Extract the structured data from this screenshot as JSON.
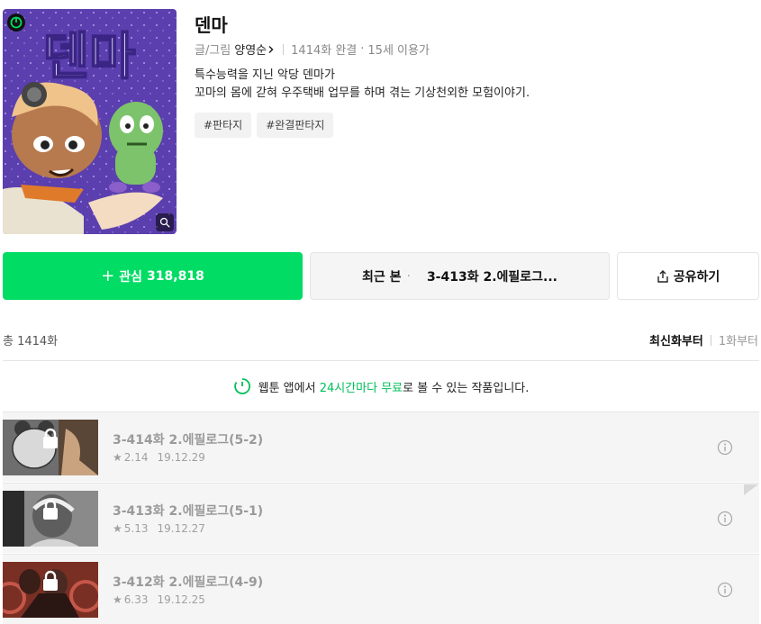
{
  "webtoon": {
    "title": "덴마",
    "cover_logo": "덴마",
    "author_prefix": "글/그림",
    "author": "양영순",
    "status": "1414화 완결",
    "age": "15세 이용가",
    "description_line1": "특수능력을 지닌 악당 덴마가",
    "description_line2": "꼬마의 몸에 갇혀 우주택배 업무를 하며 겪는 기상천외한 모험이야기.",
    "tags": [
      "#판타지",
      "#완결판타지"
    ]
  },
  "actions": {
    "favorite_label": "관심",
    "favorite_count": "318,818",
    "recent_label": "최근 본",
    "recent_episode": "3-413화 2.에필로그...",
    "share_label": "공유하기"
  },
  "list": {
    "total": "총 1414화",
    "sort_latest": "최신화부터",
    "sort_first": "1화부터",
    "notice_pre": "웹툰 앱에서 ",
    "notice_highlight": "24시간마다 무료",
    "notice_post": "로 볼 수 있는 작품입니다.",
    "episodes": [
      {
        "title": "3-414화 2.에필로그(5-2)",
        "rating": "2.14",
        "date": "19.12.29"
      },
      {
        "title": "3-413화 2.에필로그(5-1)",
        "rating": "5.13",
        "date": "19.12.27"
      },
      {
        "title": "3-412화 2.에필로그(4-9)",
        "rating": "6.33",
        "date": "19.12.25"
      }
    ]
  },
  "icons": {
    "badge": "clock-timer-icon",
    "zoom": "magnifier-icon",
    "share": "share-icon",
    "lock": "lock-icon",
    "info": "info-icon",
    "star": "star-icon"
  },
  "colors": {
    "accent": "#00dc64",
    "accent_text": "#00c05a",
    "cover_bg": "#5b3fae"
  }
}
